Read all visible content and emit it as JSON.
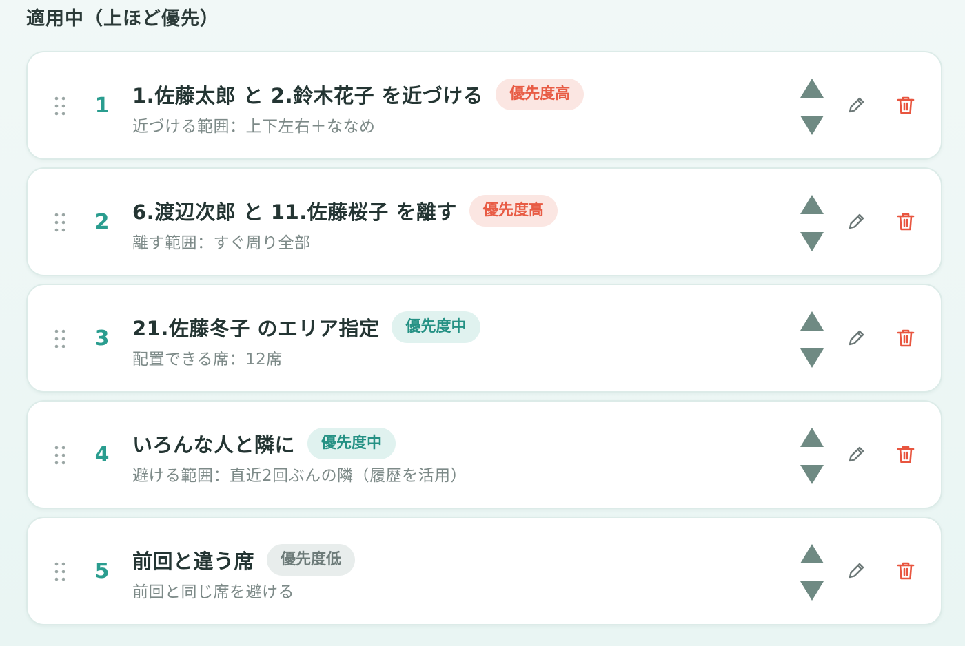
{
  "section": {
    "title": "適用中（上ほど優先）"
  },
  "colors": {
    "accent": "#2a9d8f",
    "priority_high": "#e85c45",
    "priority_mid": "#259184",
    "priority_low": "#6d7b79",
    "delete": "#e8553f"
  },
  "icons": {
    "drag": "drag-handle-icon",
    "up": "triangle-up-icon",
    "down": "triangle-down-icon",
    "edit": "pencil-icon",
    "delete": "trash-icon"
  },
  "rules": [
    {
      "number": "1",
      "title": "1.佐藤太郎 と 2.鈴木花子 を近づける",
      "priority": "優先度高",
      "priority_level": "high",
      "description": "近づける範囲：上下左右＋ななめ"
    },
    {
      "number": "2",
      "title": "6.渡辺次郎 と 11.佐藤桜子 を離す",
      "priority": "優先度高",
      "priority_level": "high",
      "description": "離す範囲：すぐ周り全部"
    },
    {
      "number": "3",
      "title": "21.佐藤冬子 のエリア指定",
      "priority": "優先度中",
      "priority_level": "mid",
      "description": "配置できる席：12席"
    },
    {
      "number": "4",
      "title": "いろんな人と隣に",
      "priority": "優先度中",
      "priority_level": "mid",
      "description": "避ける範囲：直近2回ぶんの隣（履歴を活用）"
    },
    {
      "number": "5",
      "title": "前回と違う席",
      "priority": "優先度低",
      "priority_level": "low",
      "description": "前回と同じ席を避ける"
    }
  ]
}
